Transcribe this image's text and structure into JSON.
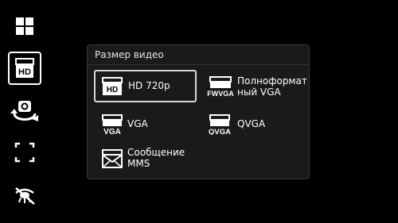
{
  "toolbar": {
    "items": [
      {
        "icon": "grid-menu-icon"
      },
      {
        "icon": "video-size-hd-icon",
        "text": "HD"
      },
      {
        "icon": "switch-camera-icon"
      },
      {
        "icon": "focus-mode-icon"
      },
      {
        "icon": "flash-off-icon"
      }
    ]
  },
  "panel": {
    "title": "Размер видео",
    "options": {
      "hd": {
        "badge": "HD",
        "label": "HD 720p",
        "selected": true
      },
      "fwvga": {
        "badge": "FWVGA",
        "label": "Полноформат\nный VGA"
      },
      "vga": {
        "badge": "VGA",
        "label": "VGA"
      },
      "qvga": {
        "badge": "QVGA",
        "label": "QVGA"
      },
      "mms": {
        "label": "Сообщение\nMMS"
      }
    }
  }
}
